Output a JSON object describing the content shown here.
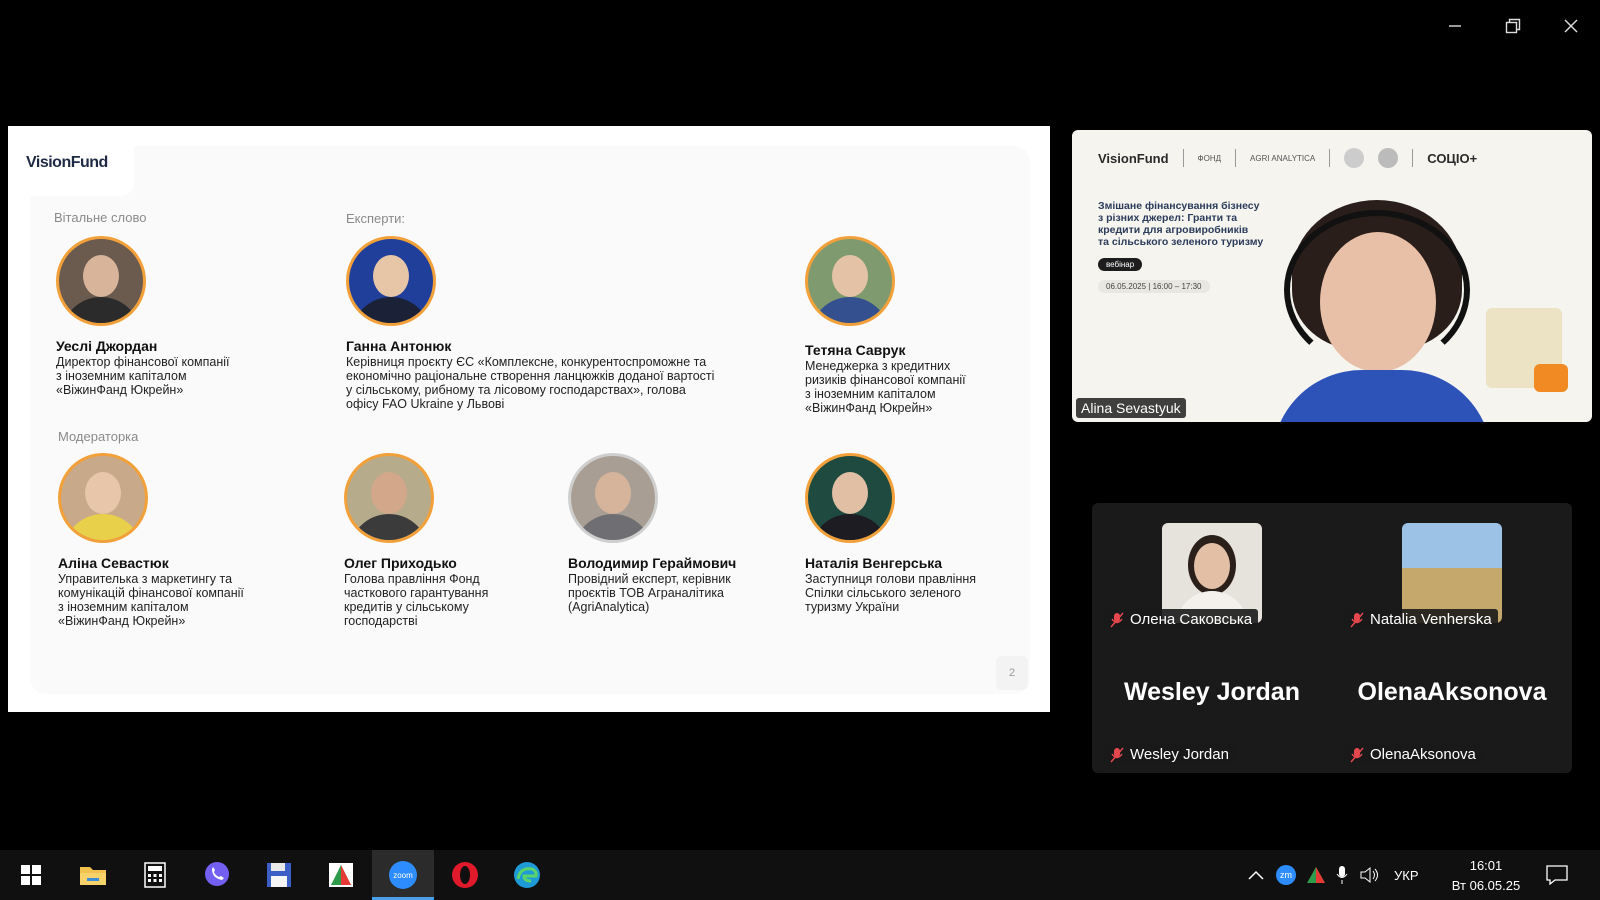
{
  "window": {
    "controls": [
      "minimize",
      "restore",
      "close"
    ]
  },
  "slide": {
    "logo_main": "Vision",
    "logo_accent": "Fund",
    "sections": {
      "welcome": "Вітальне слово",
      "experts": "Експерти:",
      "moderator": "Модераторка"
    },
    "people": [
      {
        "name": "Уеслі Джордан",
        "role": "Директор фінансової компанії\nз іноземним капіталом\n«ВіжинФанд Юкрейн»"
      },
      {
        "name": "Ганна Антонюк",
        "role": "Керівниця проєкту ЄС «Комплексне, конкурентоспроможне та\nекономічно раціональне створення ланцюжків доданої вартості\nу сільському, рибному та лісовому господарствах», голова\nофісу FAO Ukraine у Львові"
      },
      {
        "name": "Тетяна Саврук",
        "role": "Менеджерка з кредитних\nризиків фінансової компанії\nз іноземним капіталом\n«ВіжинФанд Юкрейн»"
      },
      {
        "name": "Аліна Севастюк",
        "role": "Управителька з маркетингу та\nкомунікацій фінансової компанії\nз іноземним капіталом\n«ВіжинФанд Юкрейн»"
      },
      {
        "name": "Олег Приходько",
        "role": "Голова правління Фонд\nчасткового гарантування\nкредитів у сільському\nгосподарстві"
      },
      {
        "name": "Володимир Гераймович",
        "role": "Провідний експерт, керівник\nпроєктів ТОВ Аграналітика\n(AgriAnalytica)"
      },
      {
        "name": "Наталія Венгерська",
        "role": "Заступниця голови правління\nСпілки сільського зеленого\nтуризму України"
      }
    ],
    "page_number": "2"
  },
  "speaker": {
    "logos": [
      "VisionFund",
      "ФОНД",
      "AGRI ANALYTICA",
      "СОЦІО+"
    ],
    "title": "Змішане фінансування бізнесу\nз різних джерел: Гранти та\nкредити для агровиробників\nта сільського зеленого туризму",
    "tag": "вебінар",
    "date": "06.05.2025 | 16:00 – 17:30",
    "name": "Alina Sevastyuk"
  },
  "participants": [
    {
      "label": "Олена Саковська",
      "big": "",
      "muted": true
    },
    {
      "label": "Natalia Venherska",
      "big": "",
      "muted": true
    },
    {
      "label": "Wesley Jordan",
      "big": "Wesley Jordan",
      "muted": true
    },
    {
      "label": "OlenaAksonova",
      "big": "OlenaAksonova",
      "muted": true
    }
  ],
  "taskbar": {
    "apps": [
      "start-icon",
      "file-explorer-icon",
      "calculator-icon",
      "viber-icon",
      "save-disk-icon",
      "app-icon",
      "zoom-icon",
      "opera-icon",
      "edge-icon"
    ],
    "zoom_label": "zoom",
    "tray_zoom": "zm",
    "language": "УКР",
    "time": "16:01",
    "date": "Вт 06.05.25"
  },
  "colors": {
    "accent_orange": "#f2a13a",
    "taskbar": "#101010",
    "zoom_blue": "#2d8cff",
    "speaker_shirt": "#2e53b8"
  }
}
